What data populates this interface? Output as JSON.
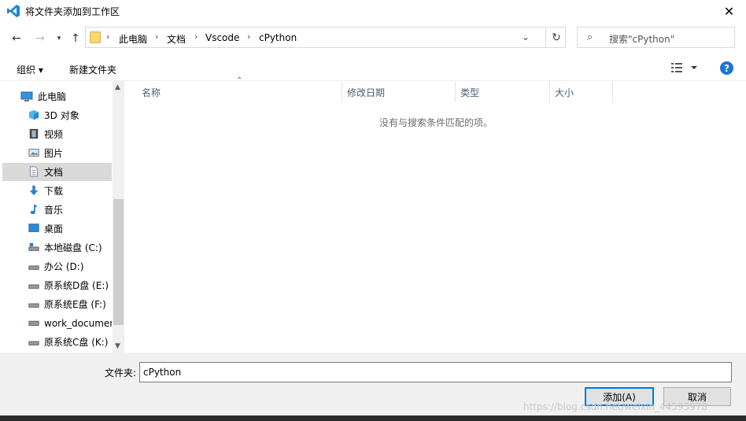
{
  "window": {
    "title": "将文件夹添加到工作区"
  },
  "address": {
    "crumbs": [
      "此电脑",
      "文档",
      "Vscode",
      "cPython"
    ]
  },
  "search": {
    "placeholder": "搜索\"cPython\""
  },
  "toolbar": {
    "organize": "组织 ▾",
    "new_folder": "新建文件夹"
  },
  "nav": {
    "items": [
      {
        "label": "此电脑",
        "icon": "computer-icon"
      },
      {
        "label": "3D 对象",
        "icon": "cube-icon"
      },
      {
        "label": "视频",
        "icon": "film-icon"
      },
      {
        "label": "图片",
        "icon": "picture-icon"
      },
      {
        "label": "文档",
        "icon": "document-icon",
        "selected": true
      },
      {
        "label": "下载",
        "icon": "download-arrow-icon"
      },
      {
        "label": "音乐",
        "icon": "music-note-icon"
      },
      {
        "label": "桌面",
        "icon": "desktop-icon"
      },
      {
        "label": "本地磁盘 (C:)",
        "icon": "drive-icon"
      },
      {
        "label": "办公 (D:)",
        "icon": "drive-icon"
      },
      {
        "label": "原系统D盘 (E:)",
        "icon": "drive-icon"
      },
      {
        "label": "原系统E盘 (F:)",
        "icon": "drive-icon"
      },
      {
        "label": "work_documer",
        "icon": "network-drive-icon"
      },
      {
        "label": "原系统C盘 (K:)",
        "icon": "drive-icon"
      }
    ]
  },
  "columns": [
    "名称",
    "修改日期",
    "类型",
    "大小"
  ],
  "empty_message": "没有与搜索条件匹配的项。",
  "bottom": {
    "folder_label": "文件夹:",
    "folder_value": "cPython",
    "add_button": "添加(A)",
    "cancel_button": "取消"
  },
  "watermark": "https://blog.csdn.net/weixin_44593978"
}
